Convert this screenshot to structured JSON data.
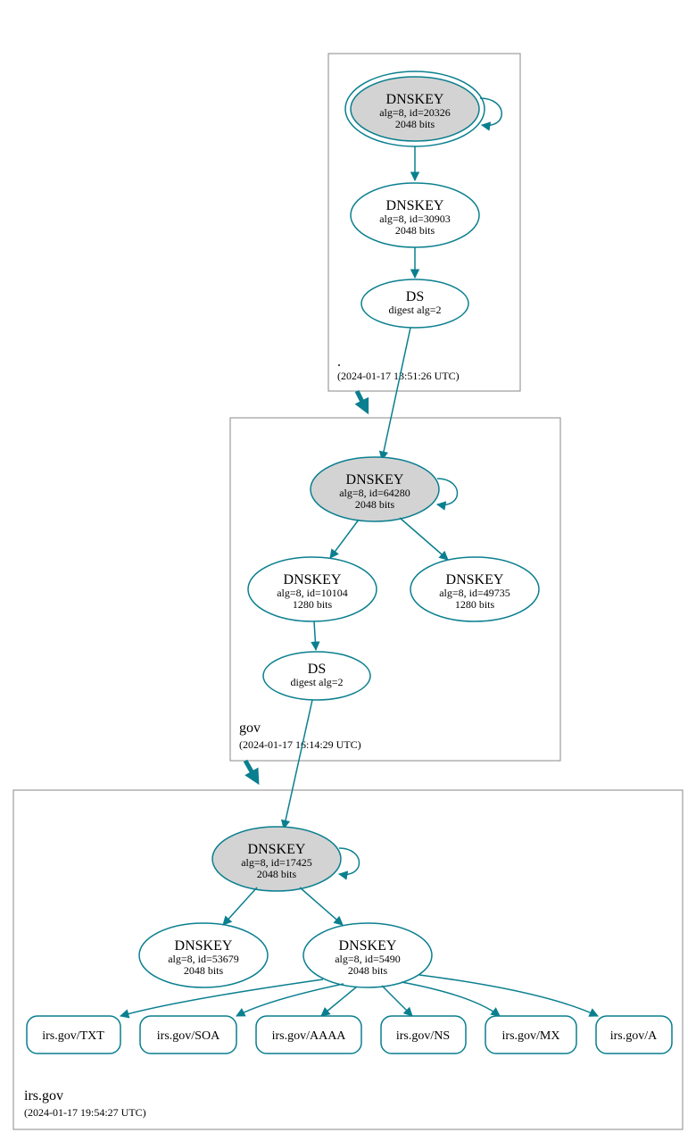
{
  "zones": {
    "root": {
      "label": ".",
      "timestamp": "(2024-01-17 13:51:26 UTC)"
    },
    "gov": {
      "label": "gov",
      "timestamp": "(2024-01-17 16:14:29 UTC)"
    },
    "irsgov": {
      "label": "irs.gov",
      "timestamp": "(2024-01-17 19:54:27 UTC)"
    }
  },
  "nodes": {
    "root_ksk": {
      "title": "DNSKEY",
      "line2": "alg=8, id=20326",
      "line3": "2048 bits"
    },
    "root_zsk": {
      "title": "DNSKEY",
      "line2": "alg=8, id=30903",
      "line3": "2048 bits"
    },
    "root_ds": {
      "title": "DS",
      "line2": "digest alg=2"
    },
    "gov_ksk": {
      "title": "DNSKEY",
      "line2": "alg=8, id=64280",
      "line3": "2048 bits"
    },
    "gov_zsk1": {
      "title": "DNSKEY",
      "line2": "alg=8, id=10104",
      "line3": "1280 bits"
    },
    "gov_zsk2": {
      "title": "DNSKEY",
      "line2": "alg=8, id=49735",
      "line3": "1280 bits"
    },
    "gov_ds": {
      "title": "DS",
      "line2": "digest alg=2"
    },
    "irs_ksk": {
      "title": "DNSKEY",
      "line2": "alg=8, id=17425",
      "line3": "2048 bits"
    },
    "irs_zsk1": {
      "title": "DNSKEY",
      "line2": "alg=8, id=53679",
      "line3": "2048 bits"
    },
    "irs_zsk2": {
      "title": "DNSKEY",
      "line2": "alg=8, id=5490",
      "line3": "2048 bits"
    }
  },
  "rrsets": {
    "txt": "irs.gov/TXT",
    "soa": "irs.gov/SOA",
    "aaaa": "irs.gov/AAAA",
    "ns": "irs.gov/NS",
    "mx": "irs.gov/MX",
    "a": "irs.gov/A"
  }
}
